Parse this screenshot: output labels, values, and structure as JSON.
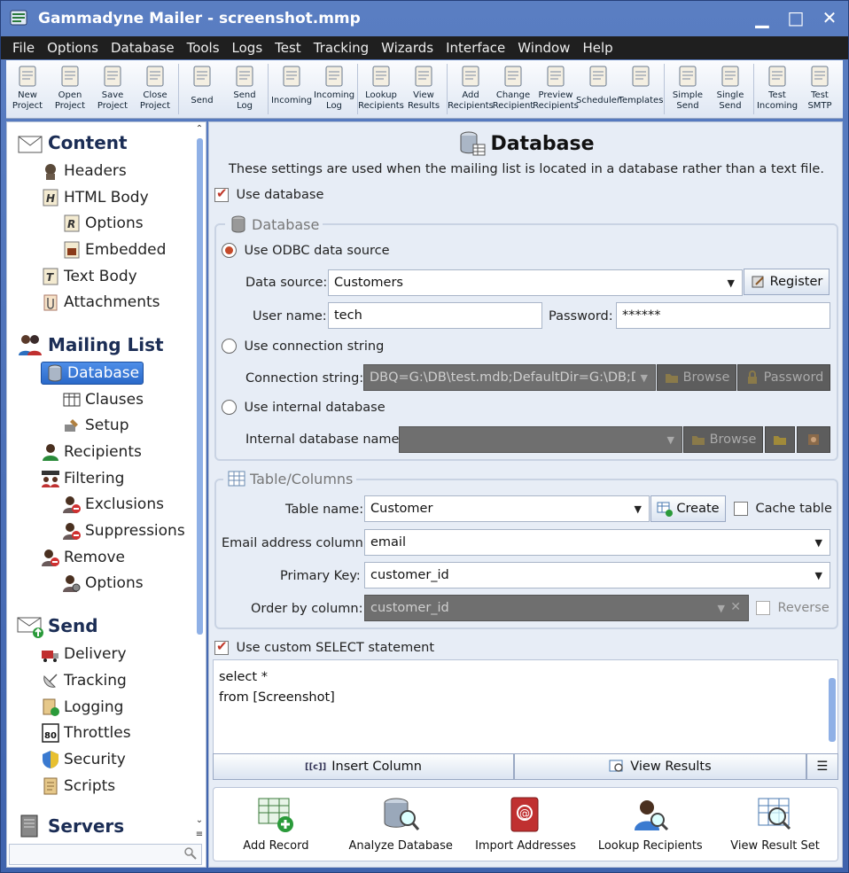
{
  "window": {
    "title": "Gammadyne Mailer - screenshot.mmp"
  },
  "menu": [
    "File",
    "Options",
    "Database",
    "Tools",
    "Logs",
    "Test",
    "Tracking",
    "Wizards",
    "Interface",
    "Window",
    "Help"
  ],
  "toolbar": [
    {
      "label": "New\nProject",
      "icon": "new-project-icon"
    },
    {
      "label": "Open\nProject",
      "icon": "open-project-icon"
    },
    {
      "label": "Save\nProject",
      "icon": "save-project-icon"
    },
    {
      "label": "Close\nProject",
      "icon": "close-project-icon"
    },
    {
      "label": "Send",
      "icon": "send-icon"
    },
    {
      "label": "Send\nLog",
      "icon": "send-log-icon"
    },
    {
      "label": "Incoming",
      "icon": "incoming-icon"
    },
    {
      "label": "Incoming\nLog",
      "icon": "incoming-log-icon"
    },
    {
      "label": "Lookup\nRecipients",
      "icon": "lookup-recipients-icon"
    },
    {
      "label": "View\nResults",
      "icon": "view-results-icon"
    },
    {
      "label": "Add\nRecipients",
      "icon": "add-recipients-icon"
    },
    {
      "label": "Change\nRecipient",
      "icon": "change-recipient-icon"
    },
    {
      "label": "Preview\nRecipients",
      "icon": "preview-recipients-icon"
    },
    {
      "label": "Scheduler",
      "icon": "scheduler-icon"
    },
    {
      "label": "Templates",
      "icon": "templates-icon"
    },
    {
      "label": "Simple\nSend",
      "icon": "simple-send-icon"
    },
    {
      "label": "Single\nSend",
      "icon": "single-send-icon"
    },
    {
      "label": "Test\nIncoming",
      "icon": "test-incoming-icon"
    },
    {
      "label": "Test\nSMTP",
      "icon": "test-smtp-icon"
    }
  ],
  "nav": {
    "content": {
      "label": "Content",
      "items": {
        "headers": "Headers",
        "html_body": "HTML Body",
        "options": "Options",
        "embedded": "Embedded",
        "text_body": "Text Body",
        "attachments": "Attachments"
      }
    },
    "mailing_list": {
      "label": "Mailing List",
      "items": {
        "database": "Database",
        "clauses": "Clauses",
        "setup": "Setup",
        "recipients": "Recipients",
        "filtering": "Filtering",
        "exclusions": "Exclusions",
        "suppressions": "Suppressions",
        "remove": "Remove",
        "options": "Options"
      }
    },
    "send": {
      "label": "Send",
      "items": {
        "delivery": "Delivery",
        "tracking": "Tracking",
        "logging": "Logging",
        "throttles": "Throttles",
        "security": "Security",
        "scripts": "Scripts"
      }
    },
    "servers": {
      "label": "Servers"
    }
  },
  "page": {
    "title": "Database",
    "description": "These settings are used when the mailing list is located in a database rather than a text file.",
    "use_database": "Use database",
    "db_group": "Database",
    "use_odbc": "Use ODBC data source",
    "data_source_label": "Data source:",
    "data_source_value": "Customers",
    "register": "Register",
    "user_name_label": "User name:",
    "user_name_value": "tech",
    "password_label": "Password:",
    "password_value": "******",
    "use_conn_string": "Use connection string",
    "conn_string_label": "Connection string:",
    "conn_string_value": "DBQ=G:\\DB\\test.mdb;DefaultDir=G:\\DB;Dr",
    "browse": "Browse",
    "password_btn": "Password",
    "use_internal": "Use internal database",
    "internal_name_label": "Internal database name:",
    "table_group": "Table/Columns",
    "table_name_label": "Table name:",
    "table_name_value": "Customer",
    "create": "Create",
    "cache_table": "Cache table",
    "email_col_label": "Email address column:",
    "email_col_value": "email",
    "pk_label": "Primary Key:",
    "pk_value": "customer_id",
    "order_label": "Order by column:",
    "order_value": "customer_id",
    "reverse": "Reverse",
    "use_custom_select": "Use custom SELECT statement",
    "sql_line1": "select *",
    "sql_line2": "from [Screenshot]",
    "insert_column": "Insert Column",
    "view_results": "View Results"
  },
  "actions": [
    "Add Record",
    "Analyze Database",
    "Import Addresses",
    "Lookup Recipients",
    "View Result Set"
  ]
}
